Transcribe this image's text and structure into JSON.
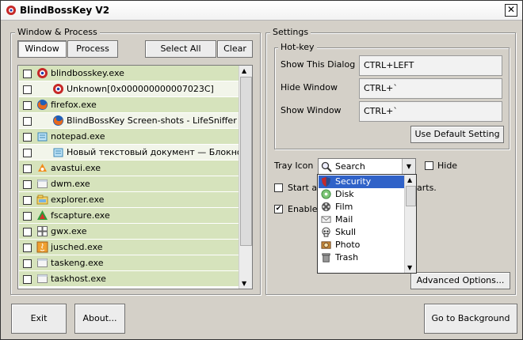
{
  "window": {
    "title": "BlindBossKey V2",
    "close": "✕"
  },
  "left": {
    "group_label": "Window & Process",
    "tab_window": "Window",
    "tab_process": "Process",
    "select_all": "Select All",
    "clear": "Clear",
    "items": [
      {
        "label": "blindbosskey.exe",
        "icon": "blindbosskey-icon",
        "indent": false,
        "bg": "green"
      },
      {
        "label": "Unknown[0x000000000007023C]",
        "icon": "blindbosskey-icon",
        "indent": true,
        "bg": "white"
      },
      {
        "label": "firefox.exe",
        "icon": "firefox-icon",
        "indent": false,
        "bg": "green"
      },
      {
        "label": "BlindBossKey Screen-shots - LifeSniffer - M...",
        "icon": "firefox-icon",
        "indent": true,
        "bg": "white"
      },
      {
        "label": "notepad.exe",
        "icon": "notepad-icon",
        "indent": false,
        "bg": "green"
      },
      {
        "label": "Новый текстовый документ — Блокнот",
        "icon": "notepad-icon",
        "indent": true,
        "bg": "white"
      },
      {
        "label": "avastui.exe",
        "icon": "avast-icon",
        "indent": false,
        "bg": "green"
      },
      {
        "label": "dwm.exe",
        "icon": "app-icon",
        "indent": false,
        "bg": "green"
      },
      {
        "label": "explorer.exe",
        "icon": "explorer-icon",
        "indent": false,
        "bg": "green"
      },
      {
        "label": "fscapture.exe",
        "icon": "fscapture-icon",
        "indent": false,
        "bg": "green"
      },
      {
        "label": "gwx.exe",
        "icon": "windows-icon",
        "indent": false,
        "bg": "green"
      },
      {
        "label": "jusched.exe",
        "icon": "java-icon",
        "indent": false,
        "bg": "green"
      },
      {
        "label": "taskeng.exe",
        "icon": "app-icon",
        "indent": false,
        "bg": "green"
      },
      {
        "label": "taskhost.exe",
        "icon": "app-icon",
        "indent": false,
        "bg": "green"
      }
    ]
  },
  "settings": {
    "group_label": "Settings",
    "hotkey_label": "Hot-key",
    "show_dialog_label": "Show This Dialog",
    "show_dialog_value": "CTRL+LEFT",
    "hide_window_label": "Hide Window",
    "hide_window_value": "CTRL+`",
    "show_window_label": "Show Window",
    "show_window_value": "CTRL+`",
    "use_default": "Use Default Setting",
    "tray_icon_label": "Tray Icon",
    "tray_selected": "Search",
    "hide_label": "Hide",
    "start_label_left": "Start au",
    "start_label_right": "arts.",
    "enable_label": "Enable",
    "advanced": "Advanced Options...",
    "dropdown": [
      {
        "label": "Security",
        "icon": "security-icon"
      },
      {
        "label": "Disk",
        "icon": "disk-icon"
      },
      {
        "label": "Film",
        "icon": "film-icon"
      },
      {
        "label": "Mail",
        "icon": "mail-icon"
      },
      {
        "label": "Skull",
        "icon": "skull-icon"
      },
      {
        "label": "Photo",
        "icon": "photo-icon"
      },
      {
        "label": "Trash",
        "icon": "trash-icon"
      }
    ]
  },
  "bottom": {
    "exit": "Exit",
    "about": "About...",
    "background": "Go to Background"
  }
}
